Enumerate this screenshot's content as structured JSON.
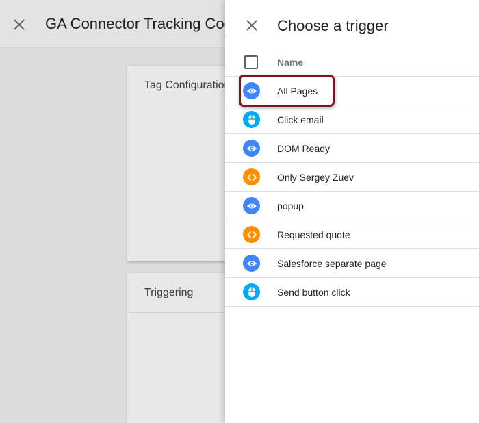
{
  "background": {
    "title": "GA Connector Tracking Code",
    "cards": {
      "tag_configuration": "Tag Configuration",
      "triggering": "Triggering"
    }
  },
  "drawer": {
    "title": "Choose a trigger",
    "header": {
      "name_column": "Name"
    },
    "triggers": [
      {
        "name": "All Pages",
        "type": "pageview",
        "icon": "eye-icon",
        "color": "#4285f4"
      },
      {
        "name": "Click email",
        "type": "click",
        "icon": "mouse-icon",
        "color": "#03a9f4"
      },
      {
        "name": "DOM Ready",
        "type": "pageview",
        "icon": "eye-icon",
        "color": "#4285f4"
      },
      {
        "name": "Only Sergey Zuev",
        "type": "custom",
        "icon": "code-icon",
        "color": "#ff8f00"
      },
      {
        "name": "popup",
        "type": "pageview",
        "icon": "eye-icon",
        "color": "#4285f4"
      },
      {
        "name": "Requested quote",
        "type": "custom",
        "icon": "code-icon",
        "color": "#ff8f00"
      },
      {
        "name": "Salesforce separate page",
        "type": "pageview",
        "icon": "eye-icon",
        "color": "#4285f4"
      },
      {
        "name": "Send button click",
        "type": "click",
        "icon": "mouse-icon",
        "color": "#03a9f4"
      }
    ],
    "highlighted_trigger": "All Pages",
    "highlight_color": "#7b1520"
  }
}
